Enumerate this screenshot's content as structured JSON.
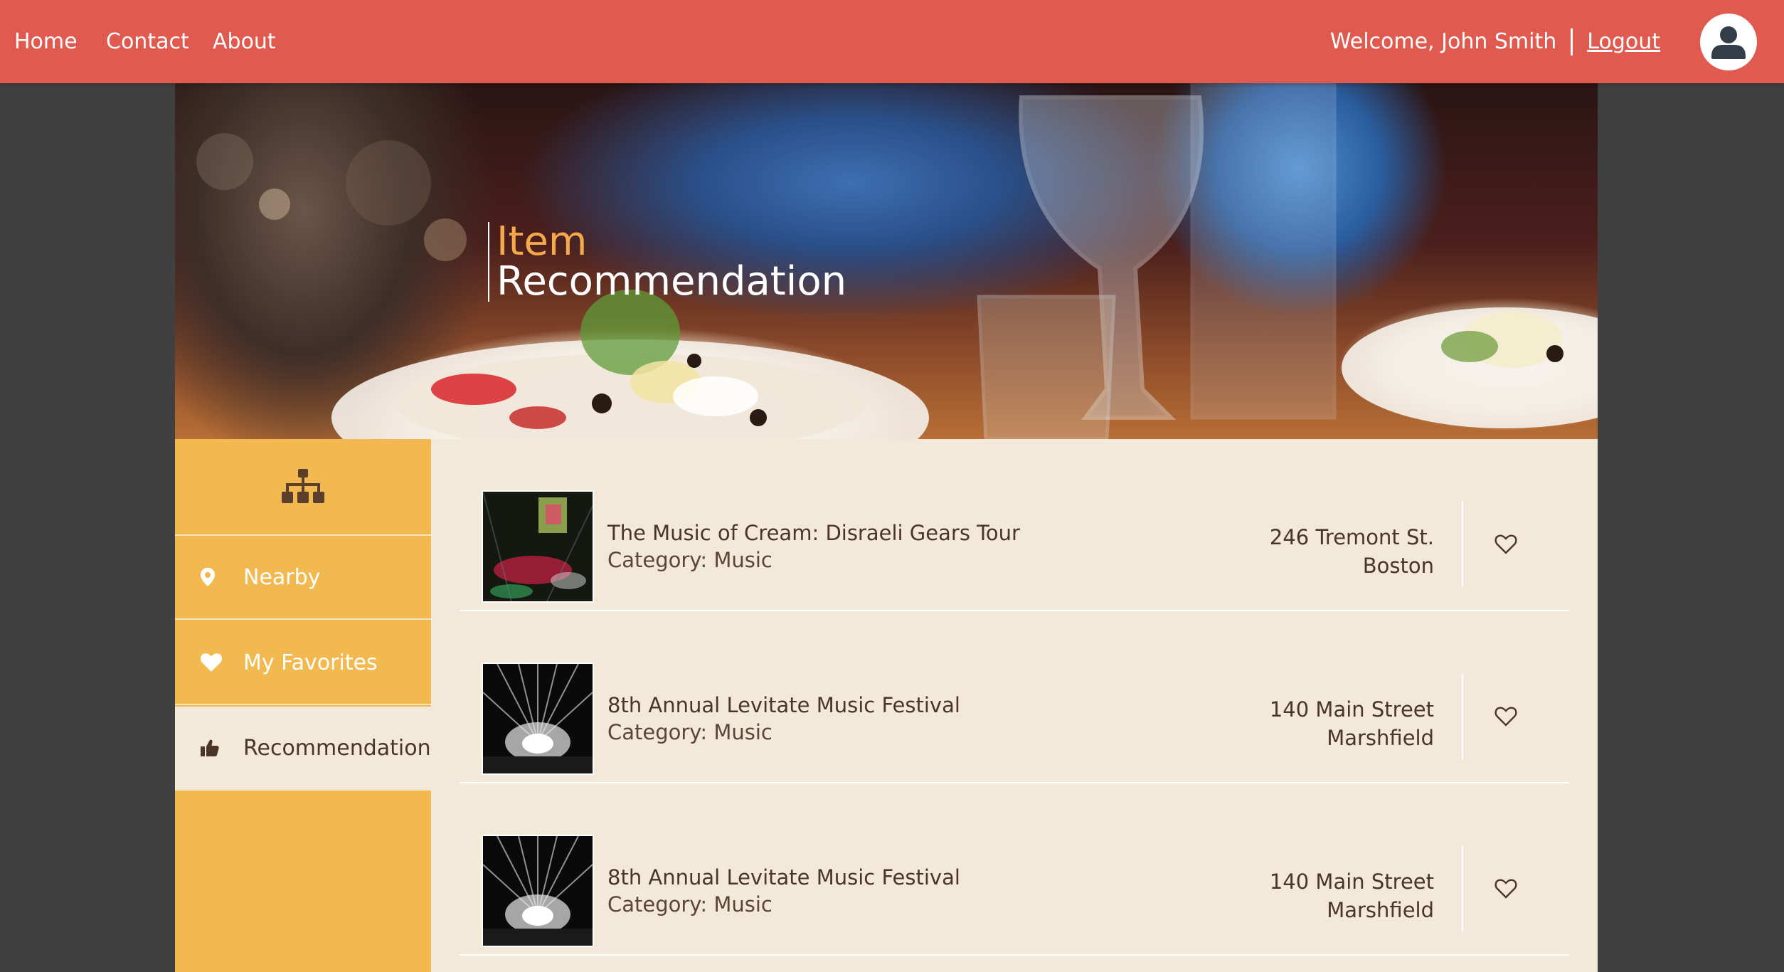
{
  "nav": {
    "links": [
      "Home",
      "Contact",
      "About"
    ],
    "welcome": "Welcome, John Smith",
    "logout": "Logout"
  },
  "hero": {
    "line1": "Item",
    "line2": "Recommendation"
  },
  "sidebar": {
    "top_icon": "sitemap-icon",
    "items": [
      {
        "label": "Nearby",
        "icon": "map-pin-icon"
      },
      {
        "label": "My Favorites",
        "icon": "heart-icon"
      },
      {
        "label": "Recommendation",
        "icon": "thumbs-up-icon",
        "active": true
      }
    ]
  },
  "items": [
    {
      "title": "The Music of Cream: Disraeli Gears Tour",
      "category": "Category: Music",
      "address_line1": "246 Tremont St.",
      "address_line2": "Boston"
    },
    {
      "title": "8th Annual Levitate Music Festival",
      "category": "Category: Music",
      "address_line1": "140 Main Street",
      "address_line2": "Marshfield"
    },
    {
      "title": "8th Annual Levitate Music Festival",
      "category": "Category: Music",
      "address_line1": "140 Main Street",
      "address_line2": "Marshfield"
    }
  ],
  "colors": {
    "nav": "#e05a4f",
    "sidebar": "#f2b950",
    "content": "#f2e9da",
    "accent": "#f5a94a",
    "text": "#4a3527",
    "page_bg": "#404040"
  }
}
